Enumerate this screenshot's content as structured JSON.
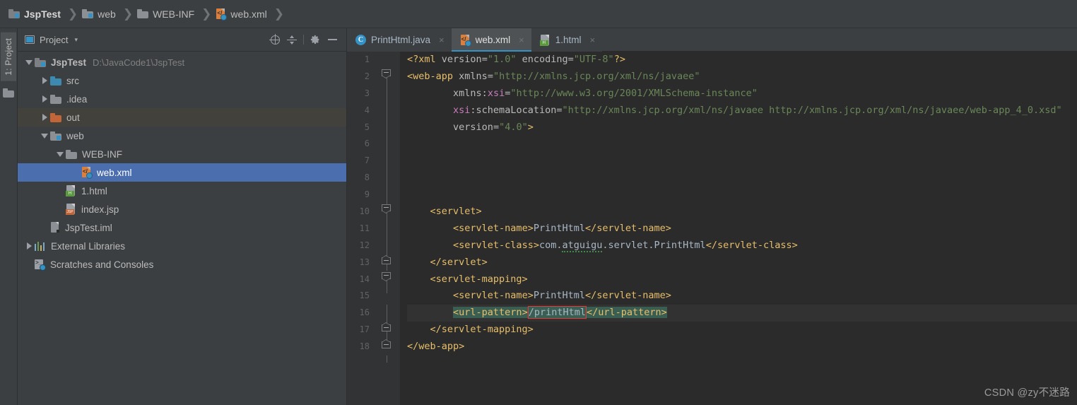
{
  "breadcrumb": {
    "items": [
      {
        "label": "JspTest",
        "icon": "folder-module-icon"
      },
      {
        "label": "web",
        "icon": "folder-web-icon"
      },
      {
        "label": "WEB-INF",
        "icon": "folder-icon"
      },
      {
        "label": "web.xml",
        "icon": "xml-file-icon"
      }
    ],
    "separator": "❯"
  },
  "toolstrip": {
    "project_tab_label": "1: Project"
  },
  "project_panel": {
    "title": "Project",
    "caret": "▾",
    "toolbar": [
      {
        "name": "locate-in-tree-button",
        "icon": "target-icon"
      },
      {
        "name": "collapse-all-button",
        "icon": "collapse-all-icon"
      },
      {
        "name": "settings-button",
        "icon": "gear-icon"
      },
      {
        "name": "hide-panel-button",
        "icon": "minimize-icon"
      }
    ],
    "tree": [
      {
        "label": "JspTest",
        "path": "D:\\JavaCode1\\JspTest",
        "indent": 0,
        "arrow": "down",
        "icon": "folder-module-icon",
        "state": "root"
      },
      {
        "label": "src",
        "path": "",
        "indent": 1,
        "arrow": "right",
        "icon": "folder-source-icon",
        "state": "normal"
      },
      {
        "label": ".idea",
        "path": "",
        "indent": 1,
        "arrow": "right",
        "icon": "folder-icon",
        "state": "normal"
      },
      {
        "label": "out",
        "path": "",
        "indent": 1,
        "arrow": "right",
        "icon": "folder-excluded-icon",
        "state": "hover"
      },
      {
        "label": "web",
        "path": "",
        "indent": 1,
        "arrow": "down",
        "icon": "folder-web-icon",
        "state": "normal"
      },
      {
        "label": "WEB-INF",
        "path": "",
        "indent": 2,
        "arrow": "down",
        "icon": "folder-icon",
        "state": "normal"
      },
      {
        "label": "web.xml",
        "path": "",
        "indent": 3,
        "arrow": "none",
        "icon": "xml-file-icon",
        "state": "selected"
      },
      {
        "label": "1.html",
        "path": "",
        "indent": 2,
        "arrow": "none",
        "icon": "html-file-icon",
        "state": "normal"
      },
      {
        "label": "index.jsp",
        "path": "",
        "indent": 2,
        "arrow": "none",
        "icon": "jsp-file-icon",
        "state": "normal"
      },
      {
        "label": "JspTest.iml",
        "path": "",
        "indent": 1,
        "arrow": "none",
        "icon": "iml-file-icon",
        "state": "normal"
      },
      {
        "label": "External Libraries",
        "path": "",
        "indent": 0,
        "arrow": "right",
        "icon": "libraries-icon",
        "state": "normal"
      },
      {
        "label": "Scratches and Consoles",
        "path": "",
        "indent": 0,
        "arrow": "none",
        "icon": "scratches-icon",
        "state": "normal"
      }
    ]
  },
  "editor": {
    "tabs": [
      {
        "label": "PrintHtml.java",
        "icon": "java-class-icon",
        "active": false,
        "close": "×"
      },
      {
        "label": "web.xml",
        "icon": "xml-file-icon",
        "active": true,
        "close": "×"
      },
      {
        "label": "1.html",
        "icon": "html-file-icon",
        "active": false,
        "close": "×"
      }
    ],
    "line_numbers": [
      "1",
      "2",
      "3",
      "4",
      "5",
      "6",
      "7",
      "8",
      "9",
      "10",
      "11",
      "12",
      "13",
      "14",
      "15",
      "16",
      "17",
      "18"
    ],
    "current_line": 16,
    "lines": {
      "l1": "<?xml version=\"1.0\" encoding=\"UTF-8\"?>",
      "l2": "<web-app xmlns=\"http://xmlns.jcp.org/xml/ns/javaee\"",
      "l3": "xmlns:xsi=\"http://www.w3.org/2001/XMLSchema-instance\"",
      "l4": "xsi:schemaLocation=\"http://xmlns.jcp.org/xml/ns/javaee http://xmlns.jcp.org/xml/ns/javaee/web-app_4_0.xsd\"",
      "l5": "version=\"4.0\">",
      "l10": "<servlet>",
      "l11": "<servlet-name>PrintHtml</servlet-name>",
      "l12": "<servlet-class>com.atguigu.servlet.PrintHtml</servlet-class>",
      "l13": "</servlet>",
      "l14": "<servlet-mapping>",
      "l15": "<servlet-name>PrintHtml</servlet-name>",
      "l16": "<url-pattern>/printHtml</url-pattern>",
      "l17": "</servlet-mapping>",
      "l18": "</web-app>"
    },
    "tokens": {
      "xml_decl_open": "<?xml",
      "attr_version": "version",
      "val_version_10": "\"1.0\"",
      "attr_encoding": "encoding",
      "val_encoding": "\"UTF-8\"",
      "xml_decl_close": "?>",
      "tag_webapp_open": "<web-app",
      "attr_xmlns": "xmlns",
      "val_xmlns": "\"http://xmlns.jcp.org/xml/ns/javaee\"",
      "attr_xmlns_prefix": "xmlns:",
      "attr_xsi": "xsi",
      "val_xsi": "\"http://www.w3.org/2001/XMLSchema-instance\"",
      "attr_xsi_prefix": "xsi",
      "attr_schemaloc": ":schemaLocation",
      "val_schemaloc": "\"http://xmlns.jcp.org/xml/ns/javaee http://xmlns.jcp.org/xml/ns/javaee/web-app_4_0.xsd\"",
      "val_version_40": "\"4.0\"",
      "gt": ">",
      "tag_servlet_open": "<servlet>",
      "tag_servlet_close": "</servlet>",
      "tag_sname_open": "<servlet-name>",
      "tag_sname_close": "</servlet-name>",
      "text_printhtml": "PrintHtml",
      "tag_sclass_open": "<servlet-class>",
      "tag_sclass_close": "</servlet-class>",
      "text_com": "com.",
      "text_atguigu": "atguigu",
      "text_servletpkg": ".servlet.PrintHtml",
      "tag_smap_open": "<servlet-mapping>",
      "tag_smap_close": "</servlet-mapping>",
      "tag_url_open": "<url-pattern>",
      "tag_url_close": "</url-pattern>",
      "text_printhtml_url": "/printHtml",
      "tag_webapp_close": "</web-app>"
    }
  },
  "watermark": {
    "text": "CSDN @zy不迷路"
  },
  "colors": {
    "panel_bg": "#3C3F41",
    "editor_bg": "#2B2B2B",
    "gutter_bg": "#313335",
    "selection_blue": "#4B6EAF",
    "hover_olive": "#43413B",
    "tag_yellow": "#E8BF6A",
    "string_green": "#6A8759",
    "text_grey": "#A9B7C6",
    "highlight_teal": "#3B5E52",
    "error_box_red": "#E03C3C",
    "accent_blue": "#3592C4"
  }
}
